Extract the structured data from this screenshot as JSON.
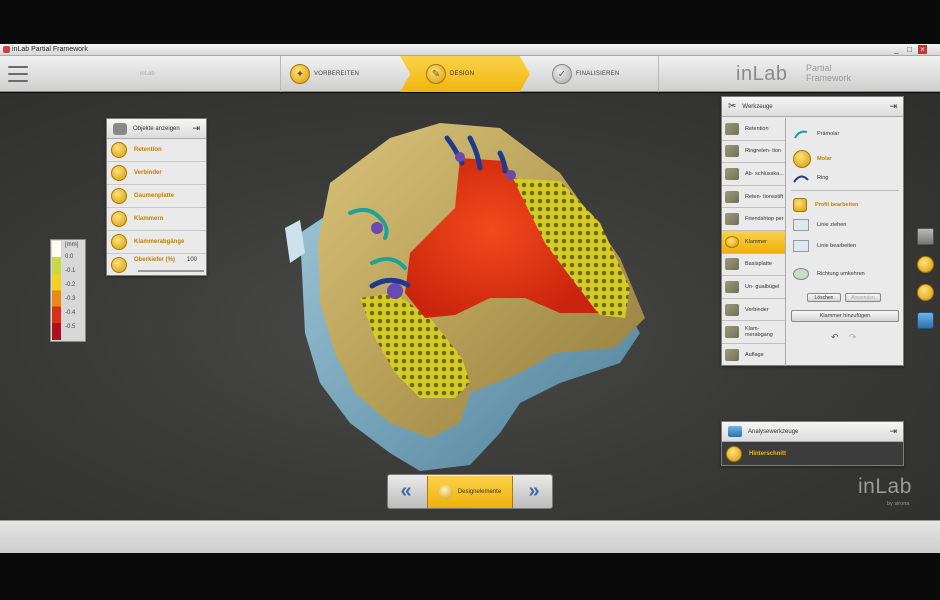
{
  "window": {
    "title": "inLab Partial Framework",
    "controls": [
      "_",
      "□",
      "×"
    ]
  },
  "toolbar": {
    "steps": [
      {
        "label": "VORBEREITEN"
      },
      {
        "label": "DESIGN"
      },
      {
        "label": "FINALISIEREN"
      }
    ],
    "placeholder_text": "inLab"
  },
  "brand": {
    "main": "inLab",
    "sub_line1": "Partial",
    "sub_line2": "Framework"
  },
  "objects_panel": {
    "title": "Objekte anzeigen",
    "items": [
      "Retention",
      "Verbinder",
      "Gaumenplatte",
      "Klammern",
      "Klammerabgänge",
      "Oberkiefer (%)"
    ],
    "slider_value": "100"
  },
  "scale": {
    "unit": "[mm]",
    "values": [
      "0.0",
      "-0.1",
      "-0.2",
      "-0.3",
      "-0.4",
      "-0.5"
    ],
    "colors": [
      "#fffff0",
      "#c8d84a",
      "#f2d21e",
      "#eb8a12",
      "#d9301c",
      "#b0101a"
    ]
  },
  "tools_panel": {
    "title": "Werkzeuge",
    "left_items": [
      "Retention",
      "Ringreten- tion",
      "Ab- schlusska...",
      "Reten- tionsstift",
      "Friendshtop per",
      "Klammer",
      "Basisplatte",
      "Un- gualbügel",
      "Verbinder",
      "Klam- merabgang",
      "Auflage"
    ],
    "selected_left": "Klammer",
    "right_items": [
      "Prämolar",
      "Molar",
      "Ring",
      "Profil bearbeiten",
      "Linie ziehen",
      "Linie bearbeiten",
      "Richtung umkehren"
    ],
    "btn_clear": "Löschen",
    "btn_apply": "Anwenden",
    "btn_add": "Klammer hinzufügen"
  },
  "analysis_panel": {
    "title": "Analysewerkzeuge",
    "item": "Hinterschnitt"
  },
  "nav": {
    "label": "Designelemente",
    "prev": "«",
    "next": "»"
  },
  "footer_logo": {
    "main": "inLab",
    "by": "by sirona"
  },
  "colors": {
    "accent": "#f0b60e",
    "active_text": "#c77e00",
    "nav_arrow": "#3d6ca8"
  }
}
